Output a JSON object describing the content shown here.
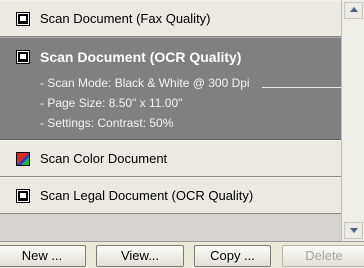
{
  "list": {
    "items": [
      {
        "label": "Scan Document (Fax Quality)",
        "icon": "scanner-document-icon",
        "selected": false
      },
      {
        "label": "Scan Document (OCR Quality)",
        "icon": "scanner-document-icon",
        "selected": true,
        "details": [
          "- Scan Mode: Black & White @ 300 Dpi",
          "- Page Size:  8.50\" x 11.00\"",
          "- Settings: Contrast: 50%"
        ]
      },
      {
        "label": "Scan Color Document",
        "icon": "color-scan-icon",
        "selected": false
      },
      {
        "label": "Scan Legal Document (OCR Quality)",
        "icon": "scanner-document-icon",
        "selected": false
      }
    ]
  },
  "buttons": {
    "new": "New ...",
    "view": "View...",
    "copy": "Copy ...",
    "delete": "Delete"
  },
  "colors": {
    "selection": "#808080",
    "list_background": "#ebe9e2"
  }
}
